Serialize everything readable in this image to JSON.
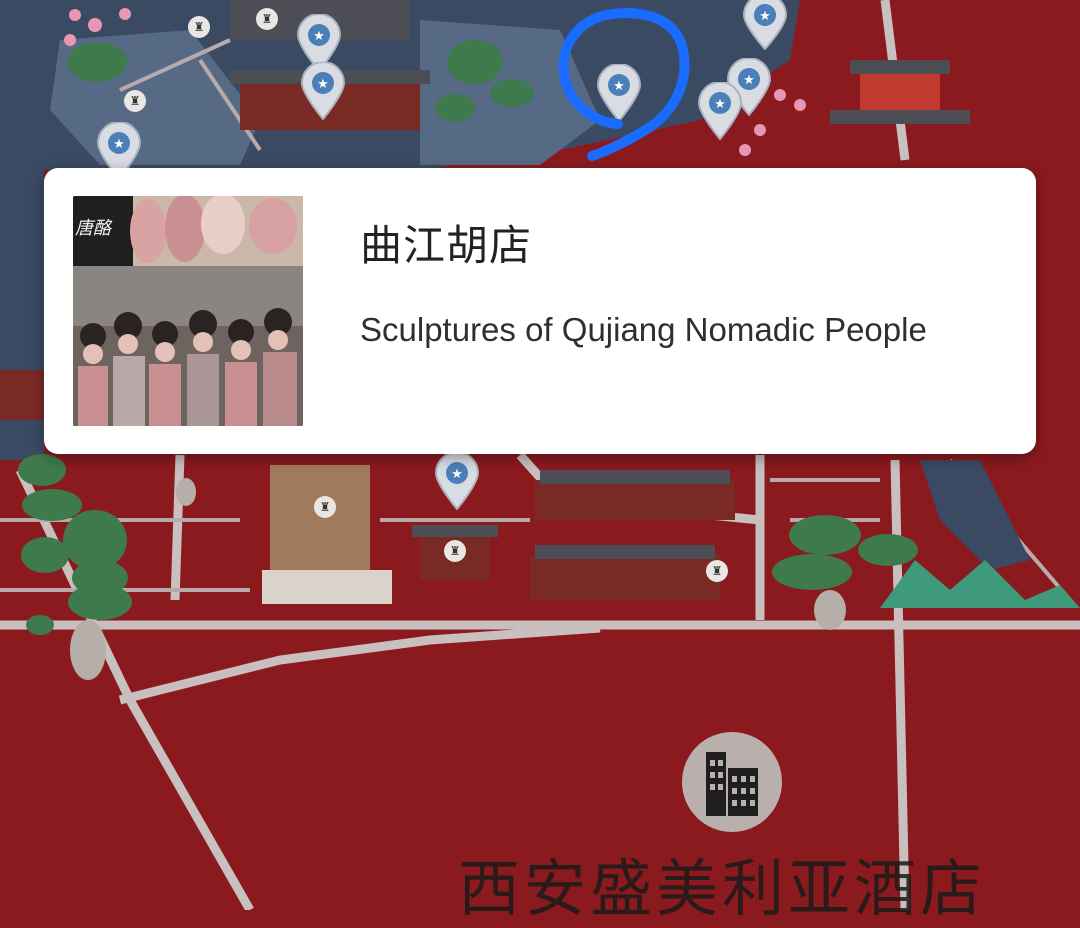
{
  "popup": {
    "title": "曲江胡店",
    "subtitle": "Sculptures of Qujiang Nomadic People",
    "thumbnail_sign": "唐酪"
  },
  "map": {
    "hotel_label": "西安盛美利亚酒店",
    "hotel_icon": "building-icon",
    "pin_icon": "star-pin-icon",
    "toilet_icon": "toilet-icon",
    "highlight_color": "#1a6bff",
    "ground_color": "#8b1a1f",
    "lake_color": "#3b4a63",
    "road_color": "#c9bfbf"
  }
}
